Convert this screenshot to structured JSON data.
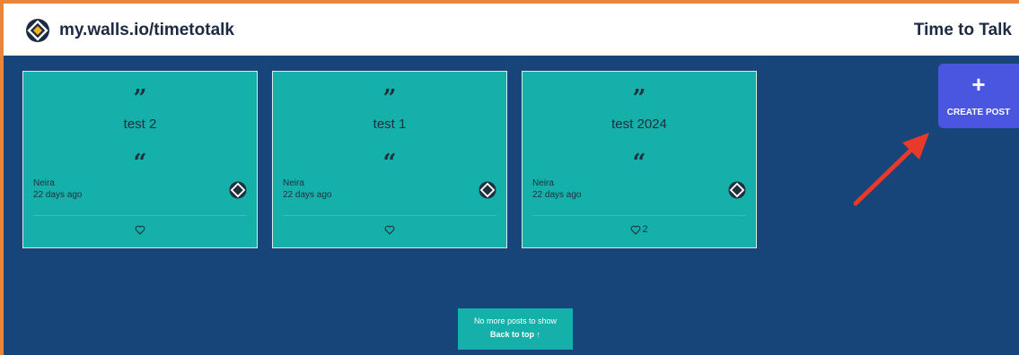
{
  "header": {
    "site_url": "my.walls.io/timetotalk",
    "wall_title": "Time to Talk"
  },
  "posts": [
    {
      "text": "test 2",
      "author": "Neira",
      "time": "22 days ago",
      "likes": ""
    },
    {
      "text": "test 1",
      "author": "Neira",
      "time": "22 days ago",
      "likes": ""
    },
    {
      "text": "test 2024",
      "author": "Neira",
      "time": "22 days ago",
      "likes": "2"
    }
  ],
  "quote_marks": {
    "close": "”",
    "open": "“"
  },
  "create_post": {
    "plus": "+",
    "label": "CREATE POST"
  },
  "footer": {
    "message": "No more posts to show",
    "back_to_top": "Back to top ↑"
  },
  "colors": {
    "wall_bg": "#17457a",
    "card_bg": "#15b0aa",
    "button_bg": "#4a55e0",
    "frame_accent": "#e8873c",
    "arrow": "#e8392b"
  },
  "icons": [
    "walls-logo-icon",
    "walls-badge-icon",
    "heart-icon",
    "plus-icon",
    "arrow-up-icon",
    "annotation-arrow"
  ]
}
